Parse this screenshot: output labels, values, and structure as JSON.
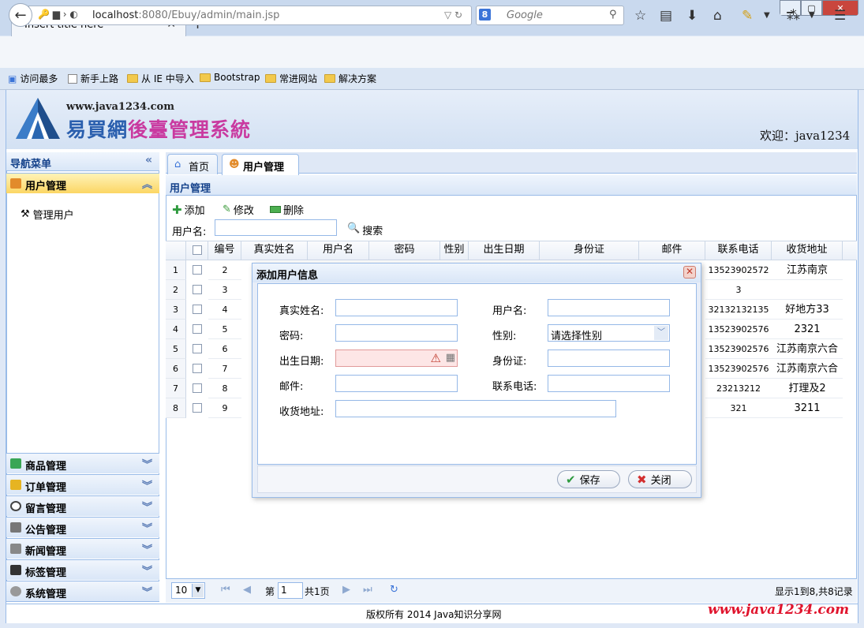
{
  "browser": {
    "tab_title": "Insert title here",
    "new_tab": "+",
    "url_host": "localhost",
    "url_rest": ":8080/Ebuy/admin/main.jsp",
    "search_placeholder": "Google",
    "bookmarks": [
      "访问最多",
      "新手上路",
      "从 IE 中导入",
      "Bootstrap",
      "常进网站",
      "解决方案"
    ]
  },
  "header": {
    "site_url": "www.java1234.com",
    "title_part1": "易買網",
    "title_part2": "後臺管理系統",
    "welcome": "欢迎：java1234"
  },
  "nav": {
    "title": "导航菜单",
    "active_section": "用户管理",
    "active_item": "管理用户",
    "sections": [
      "商品管理",
      "订单管理",
      "留言管理",
      "公告管理",
      "新闻管理",
      "标签管理",
      "系统管理"
    ]
  },
  "tabs": [
    "首页",
    "用户管理"
  ],
  "panel": {
    "title": "用户管理",
    "toolbar": {
      "add": "添加",
      "edit": "修改",
      "delete": "删除"
    },
    "search_label": "用户名:",
    "search_button": "搜索"
  },
  "grid": {
    "columns": [
      "编号",
      "真实姓名",
      "用户名",
      "密码",
      "性别",
      "出生日期",
      "身份证",
      "邮件",
      "联系电话",
      "收货地址"
    ],
    "rows": [
      {
        "n": "1",
        "id": "2",
        "phone": "13523902572",
        "addr": "江苏南京"
      },
      {
        "n": "2",
        "id": "3",
        "phone": "3",
        "addr": ""
      },
      {
        "n": "3",
        "id": "4",
        "phone": "32132132135",
        "addr": "好地方33"
      },
      {
        "n": "4",
        "id": "5",
        "phone": "13523902576",
        "addr": "2321"
      },
      {
        "n": "5",
        "id": "6",
        "phone": "13523902576",
        "addr": "江苏南京六合"
      },
      {
        "n": "6",
        "id": "7",
        "phone": "13523902576",
        "addr": "江苏南京六合"
      },
      {
        "n": "7",
        "id": "8",
        "phone": "23213212",
        "addr": "打理及2"
      },
      {
        "n": "8",
        "id": "9",
        "phone": "321",
        "addr": "3211"
      }
    ]
  },
  "pager": {
    "page_size": "10",
    "page_label_pre": "第",
    "current_page": "1",
    "page_label_post": "共1页",
    "summary": "显示1到8,共8记录"
  },
  "footer": {
    "copyright": "版权所有 2014 Java知识分享网",
    "watermark": "www.java1234.com"
  },
  "dialog": {
    "title": "添加用户信息",
    "labels": {
      "true_name": "真实姓名:",
      "user_name": "用户名:",
      "password": "密码:",
      "gender": "性别:",
      "birthday": "出生日期:",
      "id_card": "身份证:",
      "email": "邮件:",
      "phone": "联系电话:",
      "address": "收货地址:"
    },
    "gender_value": "请选择性别",
    "save": "保存",
    "close": "关闭"
  }
}
